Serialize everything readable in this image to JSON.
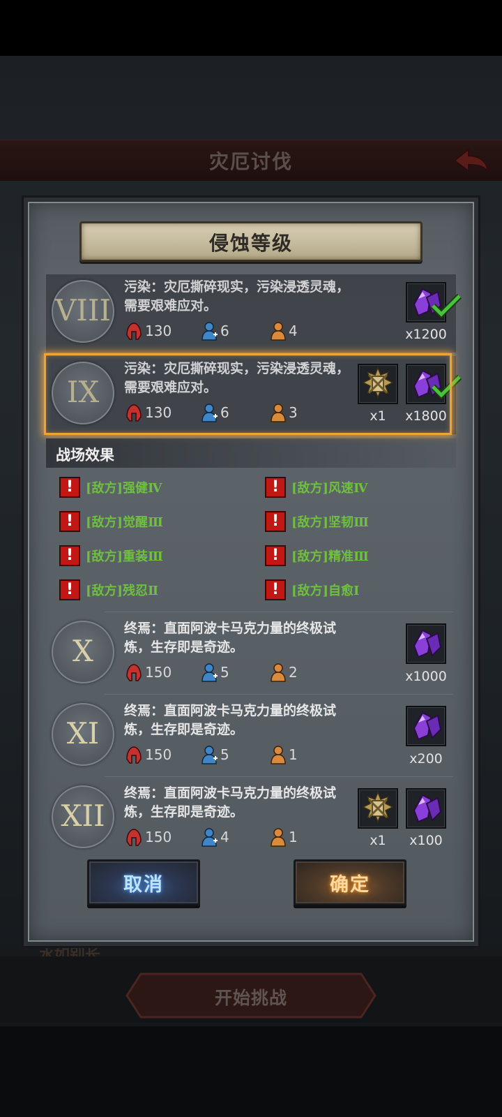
{
  "background": {
    "header_title": "灾厄讨伐",
    "start_button": "开始挑战",
    "partial_text": "水如别长"
  },
  "dialog": {
    "title": "侵蚀等级",
    "battlefield_effects_title": "战场效果",
    "cancel_label": "取消",
    "confirm_label": "确定"
  },
  "levels": [
    {
      "roman": "VIII",
      "desc_line1": "污染：灾厄撕碎现实，污染浸透灵魂，",
      "desc_line2": "需要艰难应对。",
      "helmet": "130",
      "person_blue": "6",
      "person_orange": "4",
      "rewards": [
        {
          "icon": "purple-crystal-icon",
          "count": "x1200",
          "claimed": true
        }
      ]
    },
    {
      "roman": "IX",
      "desc_line1": "污染：灾厄撕碎现实，污染浸透灵魂，",
      "desc_line2": "需要艰难应对。",
      "helmet": "130",
      "person_blue": "6",
      "person_orange": "3",
      "rewards": [
        {
          "icon": "golden-emblem-icon",
          "count": "x1",
          "claimed": false
        },
        {
          "icon": "purple-crystal-icon",
          "count": "x1800",
          "claimed": true
        }
      ]
    },
    {
      "roman": "X",
      "desc_line1": "终焉：直面阿波卡马克力量的终极试",
      "desc_line2": "炼，生存即是奇迹。",
      "helmet": "150",
      "person_blue": "5",
      "person_orange": "2",
      "rewards": [
        {
          "icon": "purple-crystal-icon",
          "count": "x1000",
          "claimed": false
        }
      ]
    },
    {
      "roman": "XI",
      "desc_line1": "终焉：直面阿波卡马克力量的终极试",
      "desc_line2": "炼，生存即是奇迹。",
      "helmet": "150",
      "person_blue": "5",
      "person_orange": "1",
      "rewards": [
        {
          "icon": "purple-crystal-icon",
          "count": "x200",
          "claimed": false
        }
      ]
    },
    {
      "roman": "XII",
      "desc_line1": "终焉：直面阿波卡马克力量的终极试",
      "desc_line2": "炼，生存即是奇迹。",
      "helmet": "150",
      "person_blue": "4",
      "person_orange": "1",
      "rewards": [
        {
          "icon": "golden-emblem-icon",
          "count": "x1",
          "claimed": false
        },
        {
          "icon": "purple-crystal-icon",
          "count": "x100",
          "claimed": false
        }
      ]
    }
  ],
  "effects": [
    "[敌方]强健Ⅳ",
    "[敌方]风速Ⅳ",
    "[敌方]觉醒Ⅲ",
    "[敌方]坚韧Ⅲ",
    "[敌方]重装Ⅲ",
    "[敌方]精准Ⅲ",
    "[敌方]残忍Ⅱ",
    "[敌方]自愈Ⅰ"
  ],
  "colors": {
    "highlight": "#f0a23a",
    "effect_text": "#6ec03e",
    "warn_red": "#c11815",
    "helmet_red": "#c4312e",
    "person_blue": "#3f86c9",
    "person_orange": "#d98a3c",
    "crystal_purple": "#8a3fd8",
    "check_green": "#49c43a"
  }
}
